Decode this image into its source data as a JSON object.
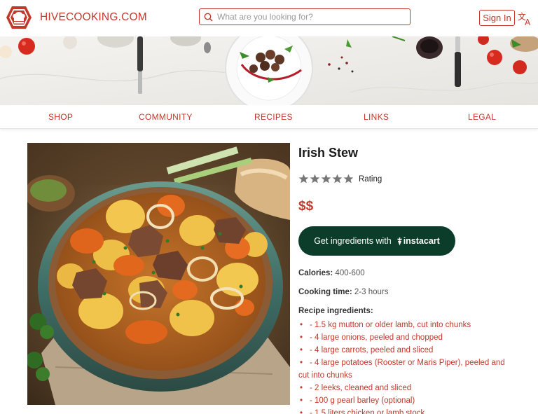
{
  "header": {
    "site_name": "HIVECOOKING.COM",
    "search_placeholder": "What are you looking for?",
    "signin_label": "Sign In",
    "logo_icon": "chef-hat-hexagon-icon",
    "translate_icon": "translate-icon"
  },
  "nav": {
    "items": [
      "SHOP",
      "COMMUNITY",
      "RECIPES",
      "LINKS",
      "LEGAL"
    ]
  },
  "recipe": {
    "title": "Irish Stew",
    "rating_label": "Rating",
    "rating_stars": 5,
    "price": "$$",
    "instacart_label": "Get ingredients with",
    "instacart_brand": "instacart",
    "calories_label": "Calories:",
    "calories_value": "400-600",
    "cooking_time_label": "Cooking time:",
    "cooking_time_value": "2-3 hours",
    "ingredients_label": "Recipe ingredients:",
    "ingredients": [
      "- 1.5 kg mutton or older lamb, cut into chunks",
      "- 4 large onions, peeled and chopped",
      "- 4 large carrots, peeled and sliced",
      "- 4 large potatoes (Rooster or Maris Piper), peeled and cut into chunks",
      "- 2 leeks, cleaned and sliced",
      "- 100 g pearl barley (optional)",
      "- 1.5 liters chicken or lamb stock"
    ]
  },
  "colors": {
    "brand_red": "#c0392b",
    "instacart_green": "#0b3d2a",
    "star_gray": "#777777"
  }
}
